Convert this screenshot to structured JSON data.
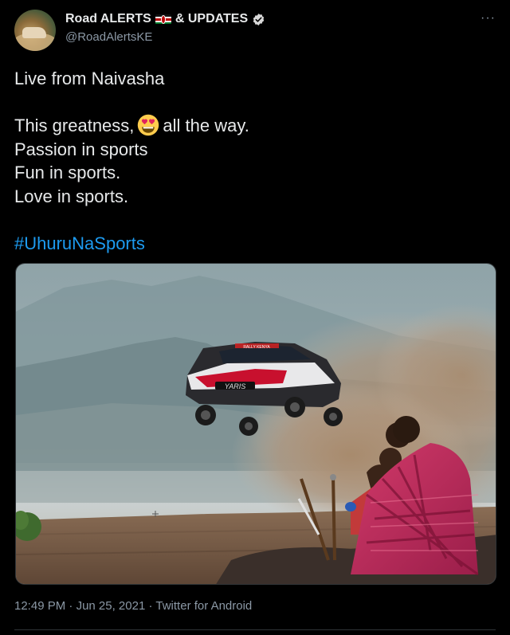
{
  "author": {
    "name_part1": "Road ALERTS",
    "name_part2": "& UPDATES",
    "handle": "@RoadAlertsKE",
    "flag_icon": "kenya-flag",
    "verified_icon": "verified-badge"
  },
  "tweet": {
    "line1": "Live from Naivasha",
    "line2_before_emoji": "This greatness,",
    "line2_emoji": "heart-eyes-emoji",
    "line2_after_emoji": "all the way.",
    "line3": "Passion in sports",
    "line4": "Fun in sports.",
    "line5": "Love in sports.",
    "hashtag": "#UhuruNaSports"
  },
  "media": {
    "car_label": "YARIS",
    "banner_text": "RALLY KENYA"
  },
  "meta": {
    "time": "12:49 PM",
    "separator": "·",
    "date": "Jun 25, 2021",
    "source": "Twitter for Android"
  },
  "colors": {
    "background": "#000000",
    "text": "#e7e9ea",
    "secondary": "#8b98a5",
    "link": "#1d9bf0"
  }
}
